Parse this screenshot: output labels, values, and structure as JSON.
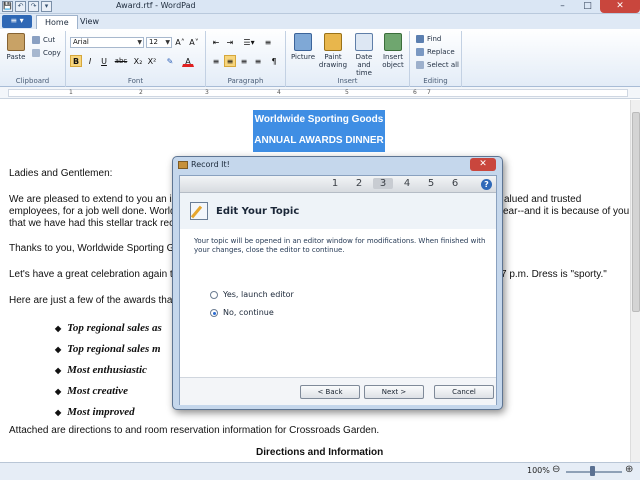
{
  "window": {
    "title": "Award.rtf - WordPad",
    "controls": [
      "–",
      "□",
      "✕"
    ]
  },
  "qat": {
    "items": [
      "💾",
      "↶",
      "↷",
      "▾"
    ]
  },
  "app_menu_label": "≡ ▾",
  "tabs": [
    {
      "label": "Home"
    },
    {
      "label": "View"
    }
  ],
  "ribbon": {
    "clipboard": {
      "label": "Clipboard",
      "paste": "Paste",
      "cut": "Cut",
      "copy": "Copy"
    },
    "font": {
      "label": "Font",
      "family": "Arial",
      "size": "12",
      "bold": "B",
      "italic": "I",
      "underline": "U",
      "strike": "abc",
      "sub": "X₂",
      "sup": "X²",
      "grow": "A˄",
      "shrink": "A˅",
      "color": "A"
    },
    "paragraph": {
      "label": "Paragraph"
    },
    "insert": {
      "label": "Insert",
      "picture": "Picture",
      "paint1": "Paint",
      "paint2": "drawing",
      "date1": "Date and",
      "date2": "time",
      "obj1": "Insert",
      "obj2": "object"
    },
    "editing": {
      "label": "Editing",
      "find": "Find",
      "replace": "Replace",
      "select_all": "Select all"
    }
  },
  "ruler": {
    "marks": [
      "1",
      "2",
      "3",
      "4",
      "5",
      "6",
      "7"
    ]
  },
  "document": {
    "heading1": "Worldwide Sporting Goods",
    "heading2": "ANNUAL AWARDS DINNER",
    "salutation": "Ladies and Gentlemen:",
    "p1_l1_left": "We are pleased to extend to you an i",
    "p1_l1_right": "alued and trusted",
    "p1_l2_left": "employees, for a job well done.  World",
    "p1_l2_right": "ear--and it is because of you",
    "p1_l3": "that we have had this stellar track reco",
    "p2": "Thanks to you, Worldwide Sporting Go",
    "p3_left": "Let's have a great celebration again th",
    "p3_right": "7 p.m. Dress is \"sporty.\"",
    "p4": "Here are just a few of the awards that",
    "bullets": [
      "Top regional sales as",
      "Top regional sales m",
      "Most enthusiastic",
      "Most creative",
      "Most improved"
    ],
    "p5": "Attached are directions to and room reservation information for Crossroads Garden.",
    "directions": "Directions and Information"
  },
  "status": {
    "zoom": "100%"
  },
  "dialog": {
    "title": "Record It!",
    "steps": [
      "1",
      "2",
      "3",
      "4",
      "5",
      "6"
    ],
    "current_step": 3,
    "heading": "Edit Your Topic",
    "description": "Your topic will be opened in an editor window for modifications. When finished with your changes, close the editor to continue.",
    "options": [
      {
        "label": "Yes, launch editor",
        "selected": false
      },
      {
        "label": "No, continue",
        "selected": true
      }
    ],
    "buttons": {
      "back": "< Back",
      "next": "Next >",
      "cancel": "Cancel"
    }
  }
}
